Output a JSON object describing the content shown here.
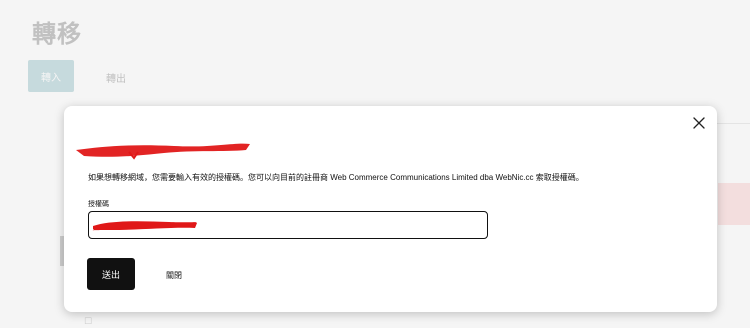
{
  "page": {
    "title": "轉移",
    "tabs": {
      "import": "轉入",
      "export": "轉出"
    },
    "footer_columns": [
      "",
      "",
      "",
      ""
    ]
  },
  "dialog": {
    "domain_name": "[redacted]",
    "description": "如果想轉移網域，您需要輸入有效的授權碼。您可以向目前的註冊商 Web Commerce Communications Limited dba WebNic.cc 索取授權碼。",
    "auth_code_label": "授權碼",
    "auth_code_value": "[redacted]",
    "submit_label": "送出",
    "close_label": "關閉"
  },
  "colors": {
    "primary_button": "#111111",
    "tab_active_bg": "#cfe3e6",
    "redaction": "#e01818"
  }
}
